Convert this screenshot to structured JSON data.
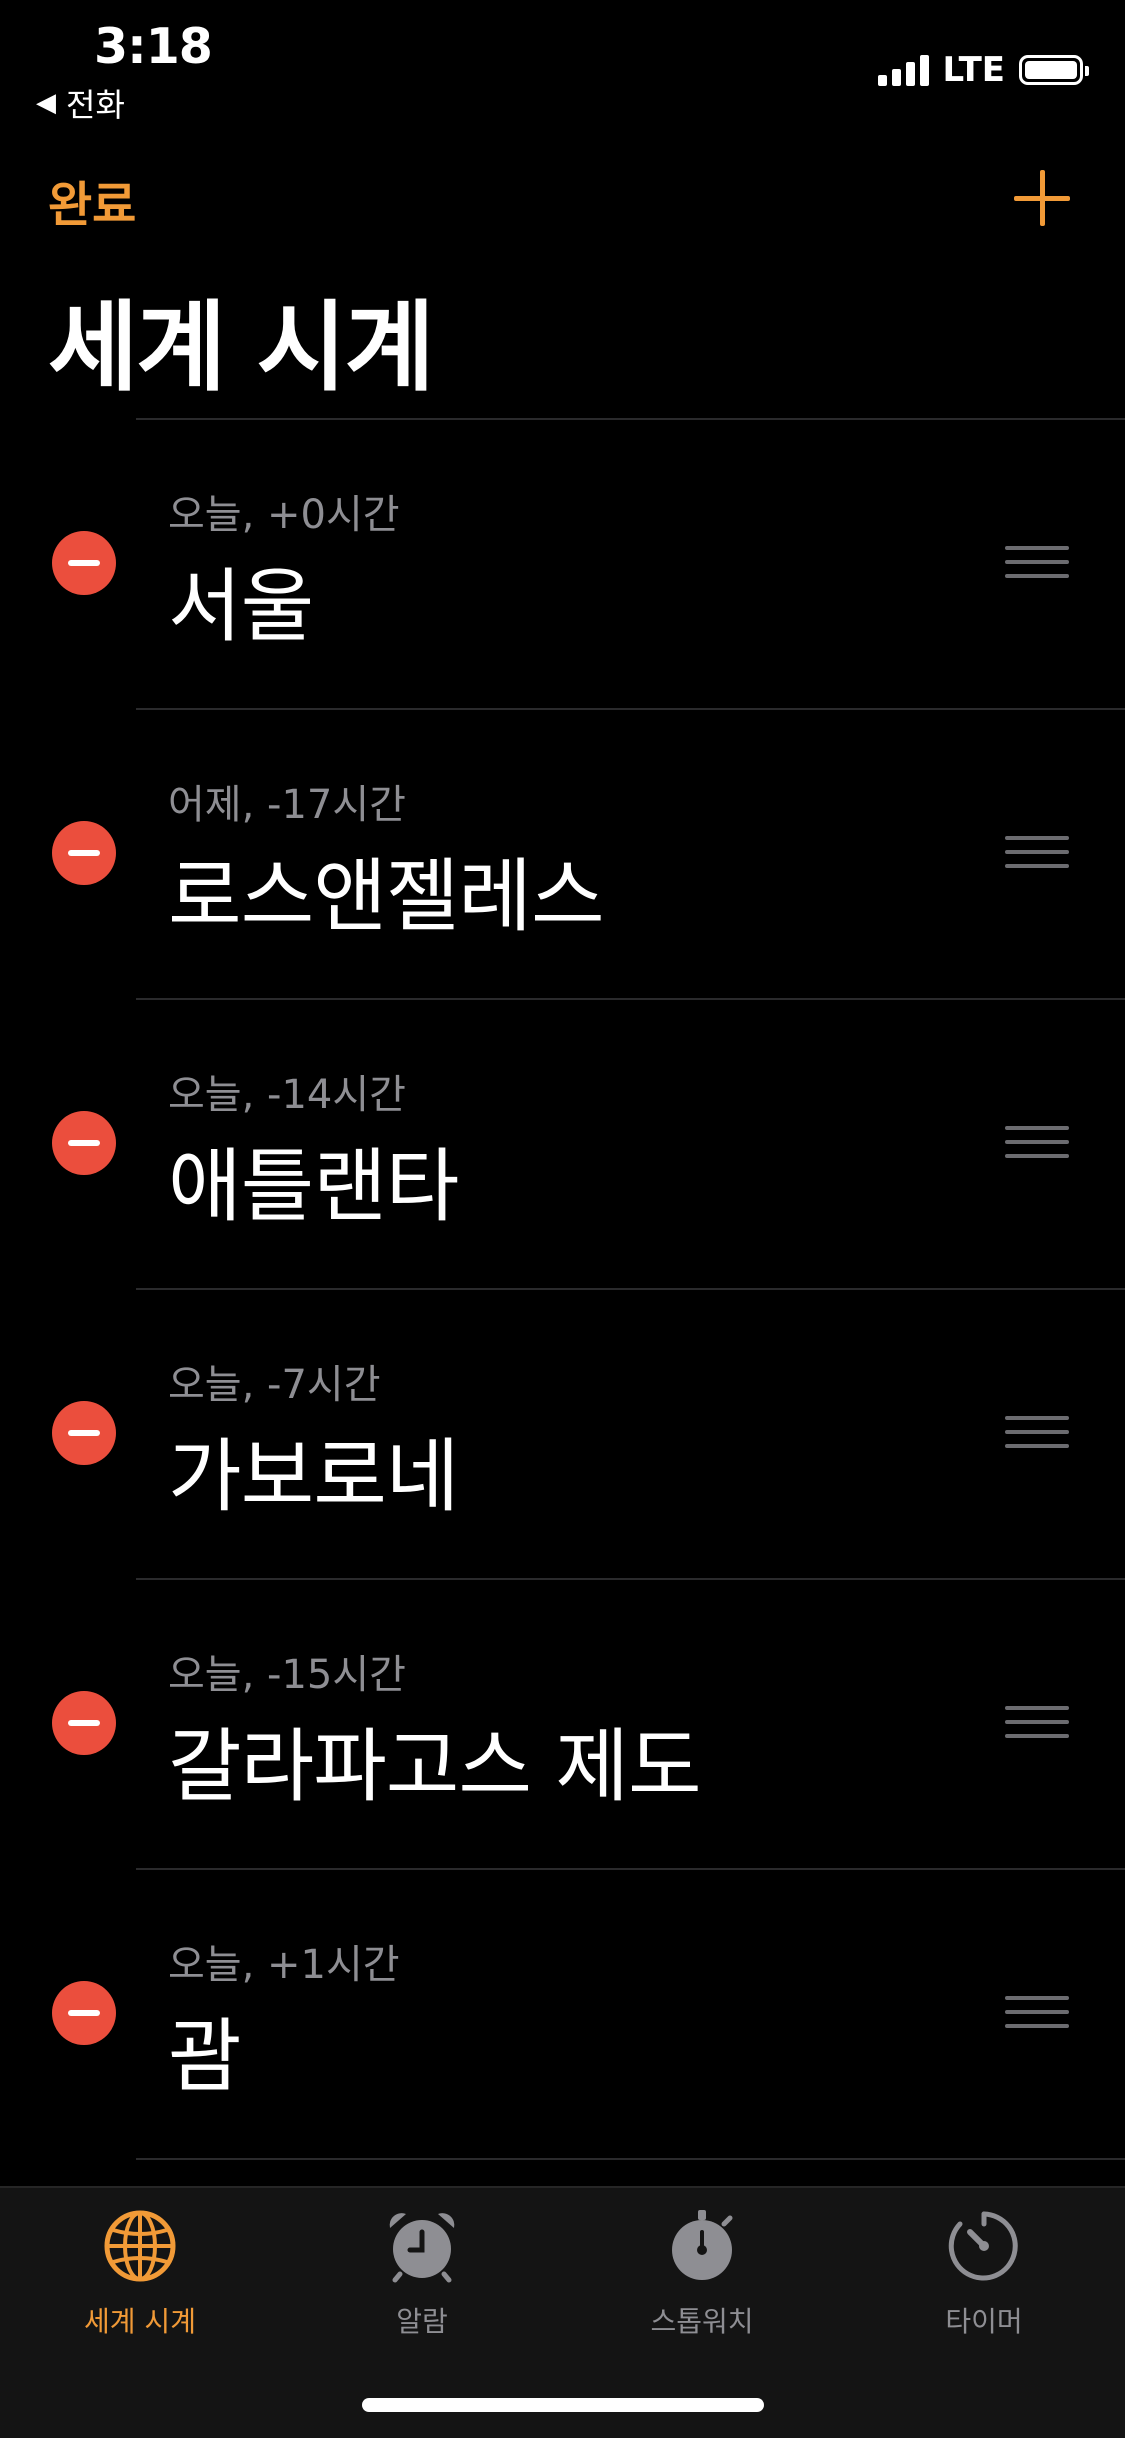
{
  "status_bar": {
    "time": "3:18",
    "back_label": "전화",
    "back_icon": "back-triangle-icon",
    "network": "LTE"
  },
  "nav": {
    "done_label": "완료",
    "add_icon": "plus-icon"
  },
  "title": "세계 시계",
  "clocks": [
    {
      "offset": "오늘, +0시간",
      "city": "서울"
    },
    {
      "offset": "어제, -17시간",
      "city": "로스앤젤레스"
    },
    {
      "offset": "오늘, -14시간",
      "city": "애틀랜타"
    },
    {
      "offset": "오늘, -7시간",
      "city": "가보로네"
    },
    {
      "offset": "오늘, -15시간",
      "city": "갈라파고스 제도"
    },
    {
      "offset": "오늘, +1시간",
      "city": "괌"
    }
  ],
  "tabs": [
    {
      "label": "세계 시계",
      "icon": "globe-icon",
      "active": true
    },
    {
      "label": "알람",
      "icon": "alarm-clock-icon",
      "active": false
    },
    {
      "label": "스톱워치",
      "icon": "stopwatch-icon",
      "active": false
    },
    {
      "label": "타이머",
      "icon": "timer-icon",
      "active": false
    }
  ],
  "colors": {
    "accent": "#F19A37",
    "delete": "#EB4E3D",
    "secondary_text": "#8E8E93",
    "background": "#000000"
  }
}
